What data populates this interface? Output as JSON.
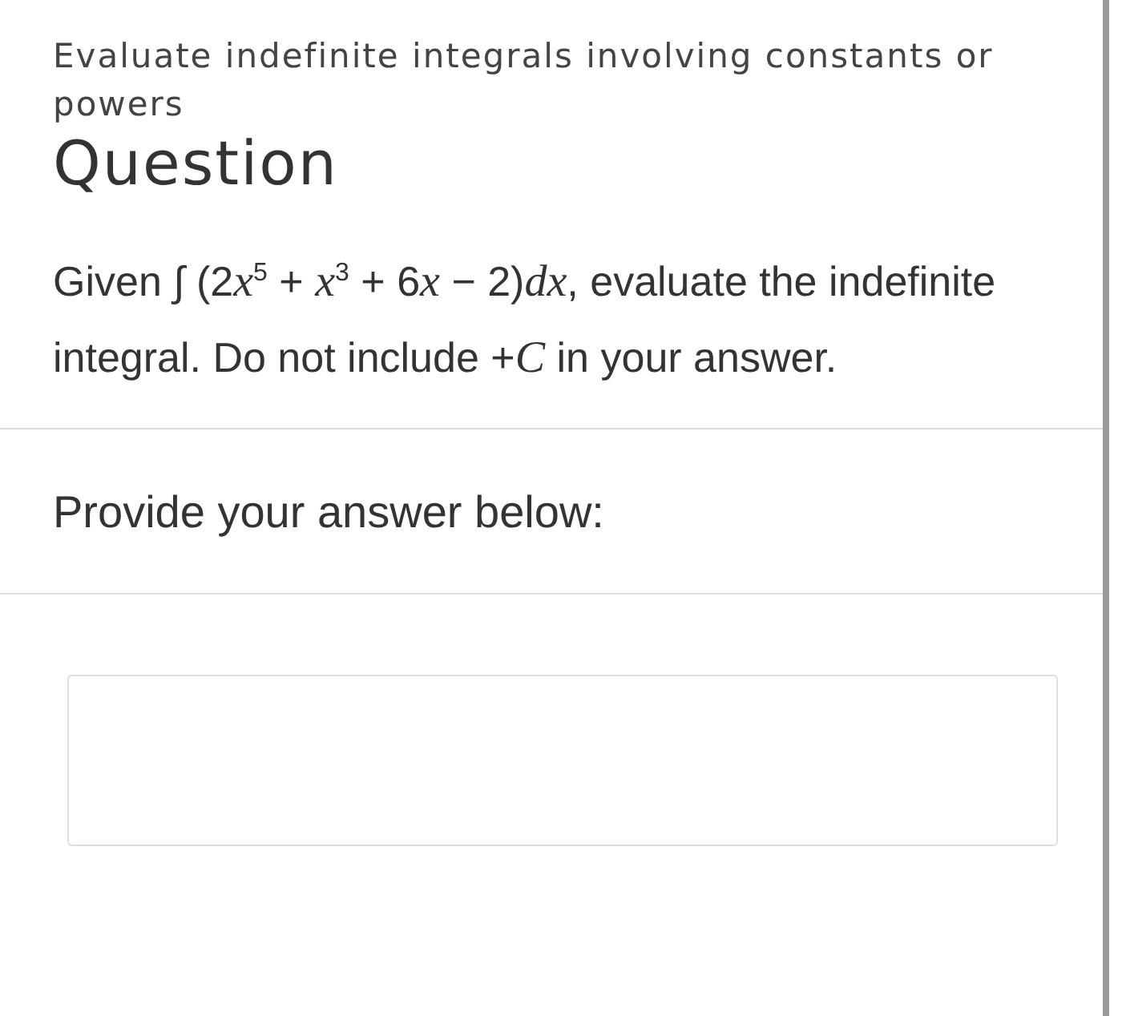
{
  "header": {
    "topic": "Evaluate indefinite integrals involving constants or powers",
    "title": "Question"
  },
  "question": {
    "parts": [
      {
        "kind": "text",
        "text": "Given ∫ (2"
      },
      {
        "kind": "var",
        "text": "x"
      },
      {
        "kind": "sup",
        "text": "5"
      },
      {
        "kind": "text",
        "text": " + "
      },
      {
        "kind": "var",
        "text": "x"
      },
      {
        "kind": "sup",
        "text": "3"
      },
      {
        "kind": "text",
        "text": " + 6"
      },
      {
        "kind": "var",
        "text": "x"
      },
      {
        "kind": "text",
        "text": " − 2)"
      },
      {
        "kind": "var",
        "text": "dx"
      },
      {
        "kind": "text",
        "text": ", evaluate the indefinite integral. Do not include +"
      },
      {
        "kind": "var",
        "text": "C"
      },
      {
        "kind": "text",
        "text": " in your answer."
      }
    ]
  },
  "answer": {
    "prompt": "Provide your answer below:"
  }
}
